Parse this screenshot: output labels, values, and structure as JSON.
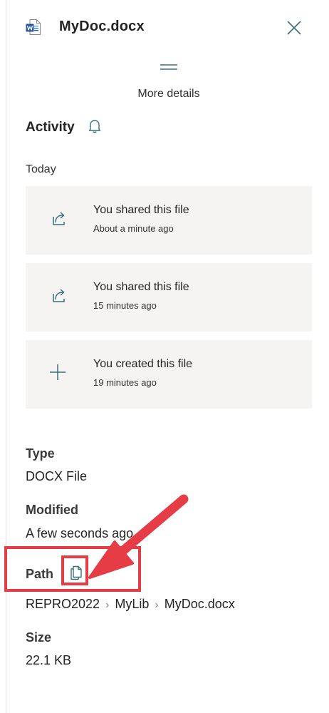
{
  "header": {
    "file_name": "MyDoc.docx",
    "file_icon": "word-document-icon",
    "close_icon": "close-icon"
  },
  "more_details": {
    "label": "More details",
    "icon": "grip-icon"
  },
  "activity": {
    "title": "Activity",
    "bell_icon": "bell-icon",
    "group_label": "Today",
    "items": [
      {
        "title": "You shared this file",
        "time": "About a minute ago",
        "icon": "share-icon"
      },
      {
        "title": "You shared this file",
        "time": "15 minutes ago",
        "icon": "share-icon"
      },
      {
        "title": "You created this file",
        "time": "19 minutes ago",
        "icon": "plus-icon"
      }
    ]
  },
  "details": {
    "type_label": "Type",
    "type_value": "DOCX File",
    "modified_label": "Modified",
    "modified_value": "A few seconds ago",
    "path_label": "Path",
    "path_copy_icon": "copy-icon",
    "path": [
      "REPRO2022",
      "MyLib",
      "MyDoc.docx"
    ],
    "size_label": "Size",
    "size_value": "22.1 KB"
  },
  "colors": {
    "annotation_red": "#e63c45",
    "icon_teal": "#3a6f76",
    "card_bg": "#f5f4f3",
    "word_blue": "#2b579a"
  }
}
